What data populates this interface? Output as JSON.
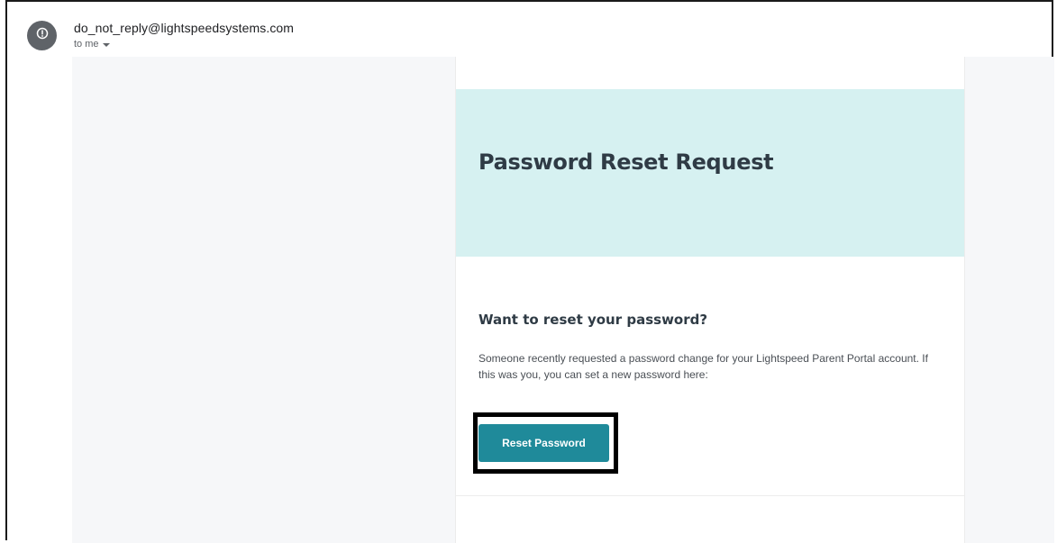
{
  "email": {
    "sender": "do_not_reply@lightspeedsystems.com",
    "recipient": "to me"
  },
  "content": {
    "title": "Password Reset Request",
    "subheading": "Want to reset your password?",
    "body": "Someone recently requested a password change for your Lightspeed Parent Portal account. If this was you, you can set a new password here:",
    "button_label": "Reset Password"
  },
  "colors": {
    "hero_background": "#d6f1f1",
    "button": "#1f8a9a",
    "heading_text": "#2f3b45"
  },
  "icons": {
    "avatar": "info-circle-icon",
    "recipient_menu": "caret-down-icon"
  }
}
